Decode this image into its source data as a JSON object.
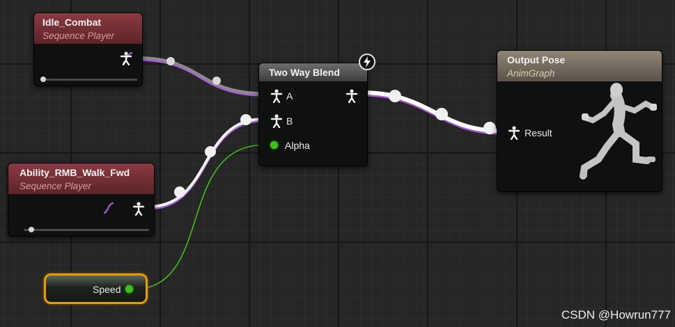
{
  "nodes": {
    "idle_combat": {
      "title": "Idle_Combat",
      "subtitle": "Sequence Player"
    },
    "ability_walk": {
      "title": "Ability_RMB_Walk_Fwd",
      "subtitle": "Sequence Player"
    },
    "two_way_blend": {
      "title": "Two Way Blend",
      "pin_a": "A",
      "pin_b": "B",
      "pin_alpha": "Alpha"
    },
    "output_pose": {
      "title": "Output Pose",
      "subtitle": "AnimGraph",
      "pin_result": "Result"
    },
    "speed": {
      "label": "Speed"
    }
  },
  "icons": {
    "pose": "person-icon",
    "sequence": "sequence-curve-icon",
    "fast_path": "lightning-bolt-icon",
    "preview": "mannequin-running-icon"
  },
  "colors": {
    "pose_wire": "#ffffff",
    "sequence_accent": "#a65bd6",
    "bool_pin": "#3fbf1a",
    "variable_outline": "#e69f00"
  },
  "watermark": "CSDN @Howrun777"
}
